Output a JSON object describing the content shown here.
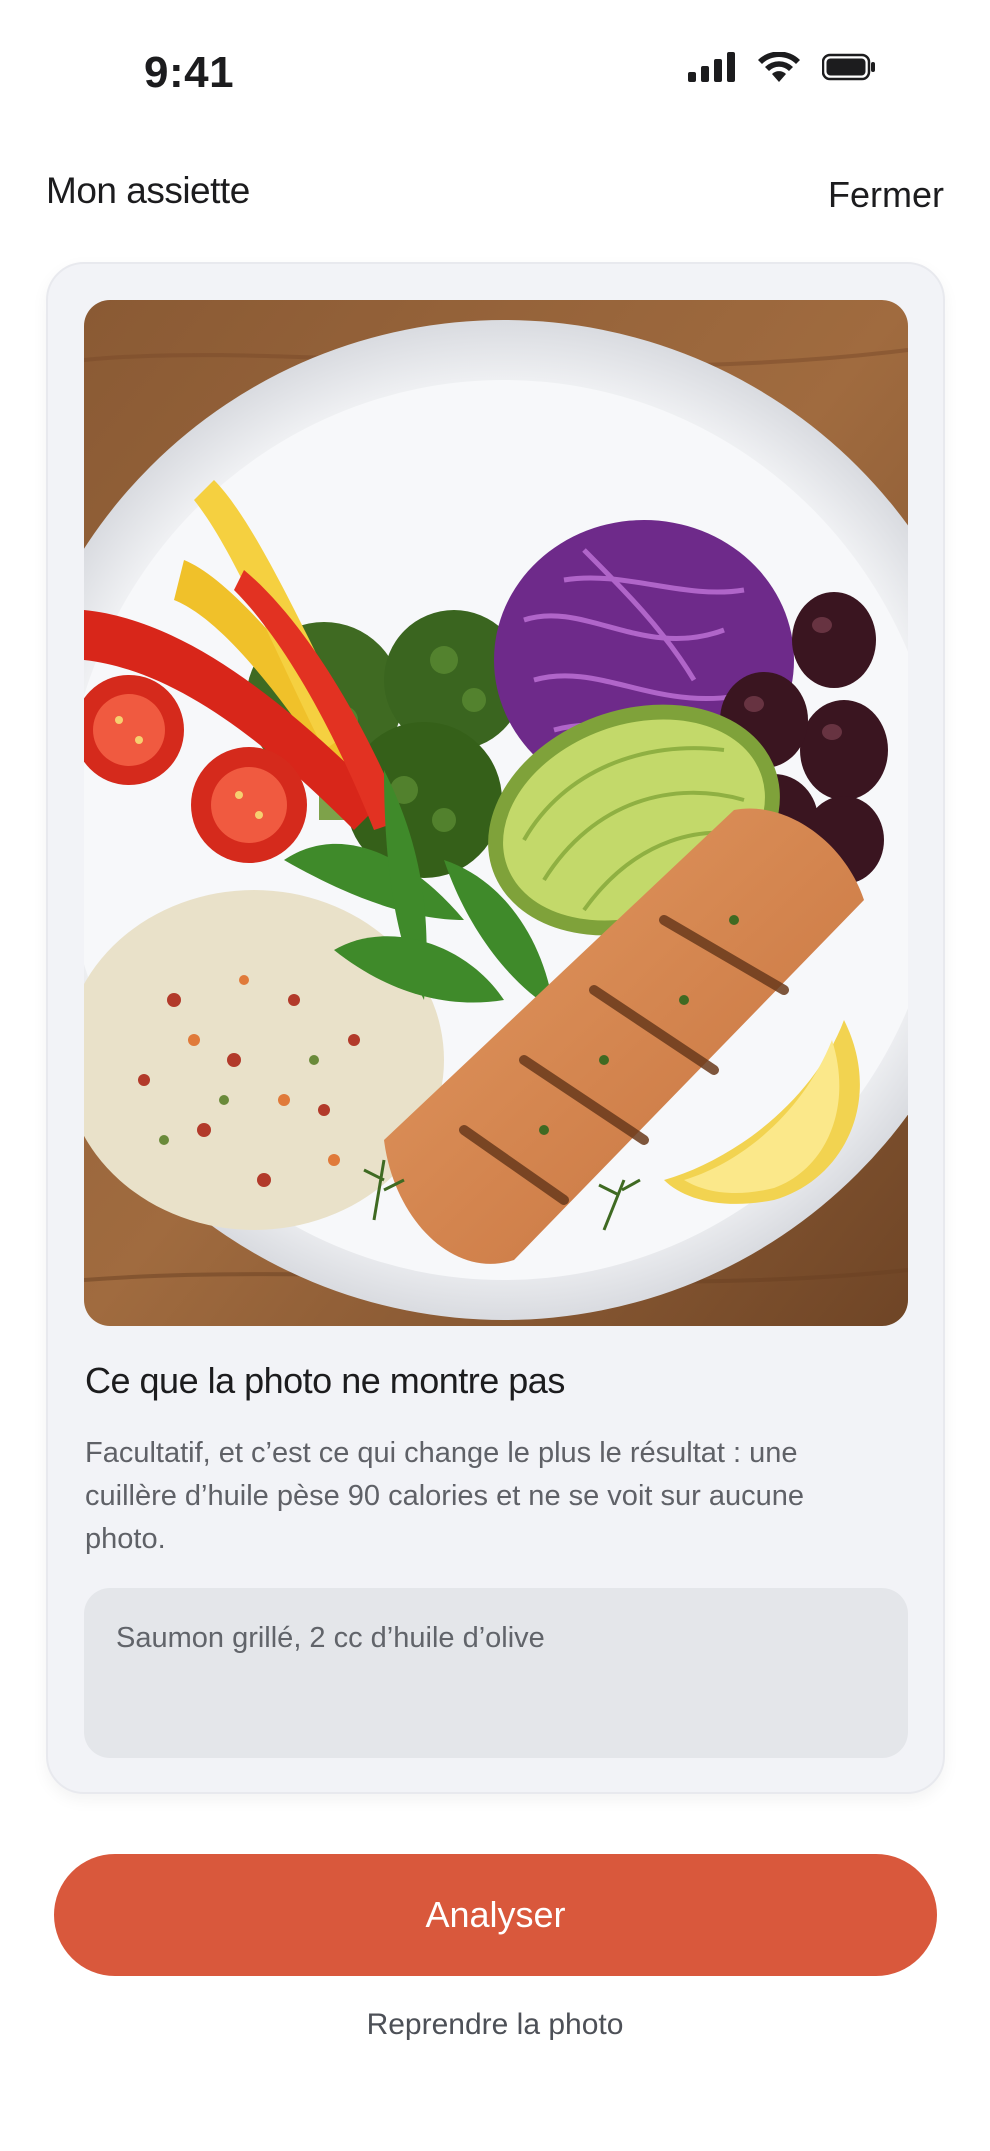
{
  "status_bar": {
    "time": "9:41",
    "icons": [
      "signal-icon",
      "wifi-icon",
      "battery-icon"
    ]
  },
  "header": {
    "title": "Mon assiette",
    "close_label": "Fermer"
  },
  "photo": {
    "subject": "meal-plate"
  },
  "notes": {
    "title": "Ce que la photo ne montre pas",
    "description": "Facultatif, et c’est ce qui change le plus le résultat : une cuillère d’huile pèse 90 calories et ne se voit sur aucune photo.",
    "placeholder": "Saumon grillé, 2 cc d’huile d’olive"
  },
  "actions": {
    "analyze_label": "Analyser",
    "retake_label": "Reprendre la photo"
  },
  "colors": {
    "accent": "#d9583c",
    "card_background": "#f2f3f7",
    "input_background": "#e4e6ea"
  }
}
